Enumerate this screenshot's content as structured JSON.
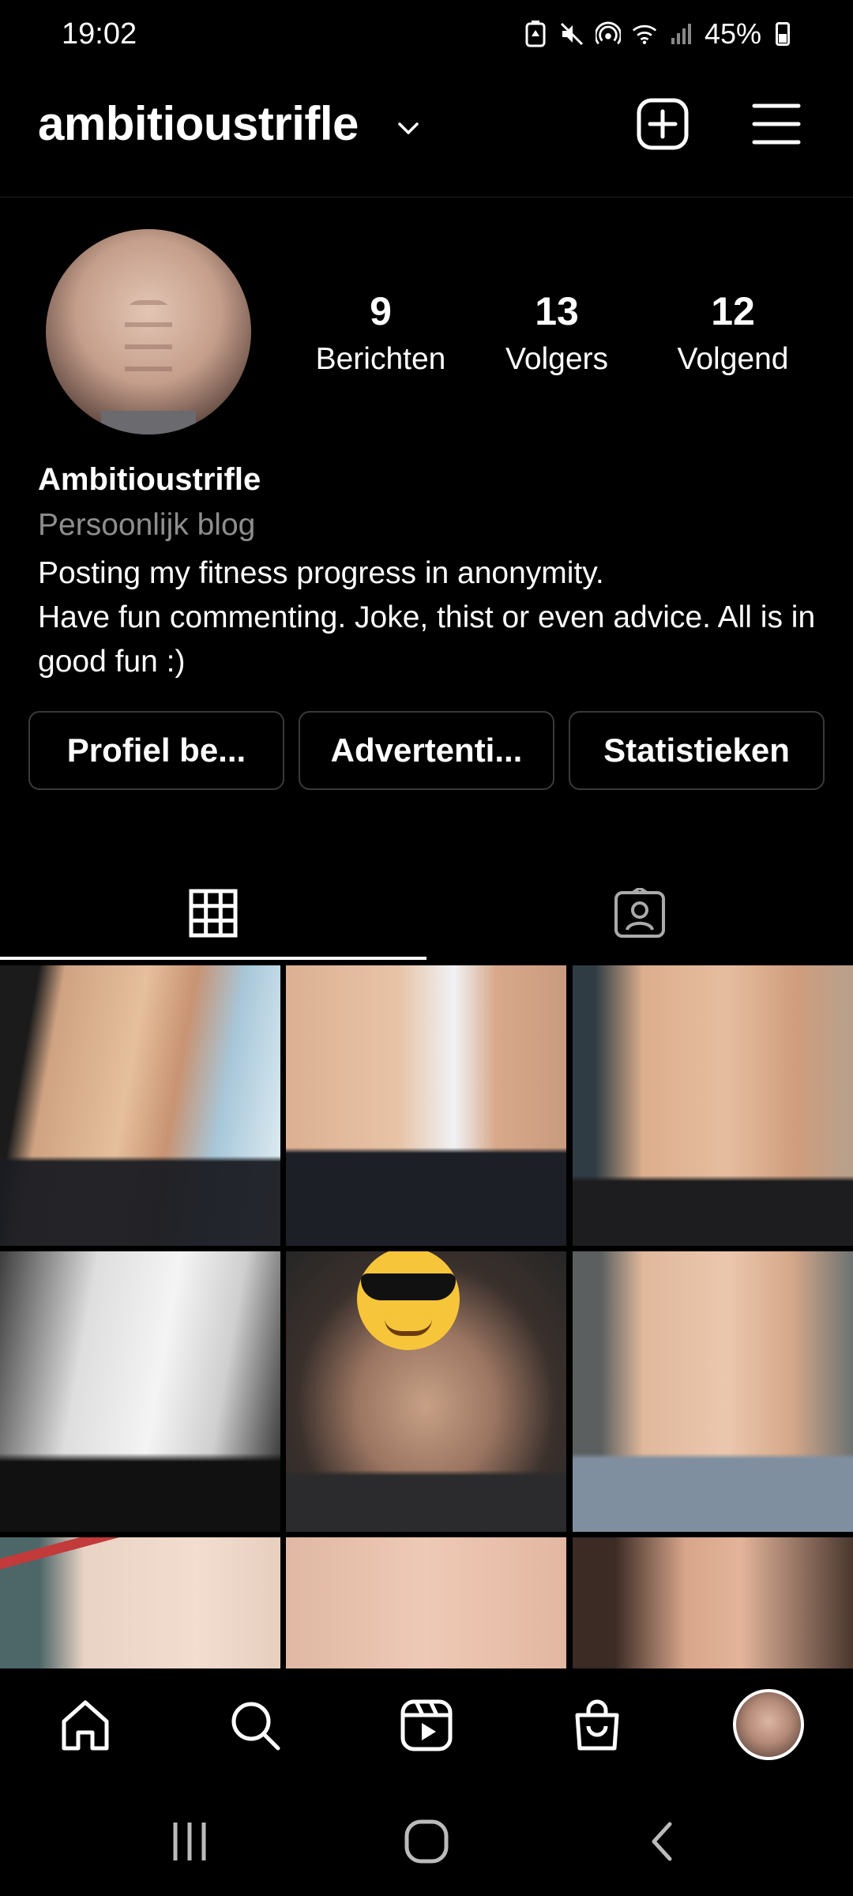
{
  "status_bar": {
    "time": "19:02",
    "battery_percent": "45%",
    "battery_level": 0.45,
    "icons": [
      "battery-saver-icon",
      "mute-icon",
      "hotspot-icon",
      "wifi-icon",
      "signal-icon"
    ]
  },
  "header": {
    "username": "ambitioustrifle",
    "icons": [
      "chevron-down-icon",
      "add-post-icon",
      "menu-icon"
    ]
  },
  "profile": {
    "stats": [
      {
        "count": "9",
        "label": "Berichten"
      },
      {
        "count": "13",
        "label": "Volgers"
      },
      {
        "count": "12",
        "label": "Volgend"
      }
    ],
    "display_name": "Ambitioustrifle",
    "category": "Persoonlijk blog",
    "bio_line1": "Posting my fitness progress in anonymity.",
    "bio_line2": "Have fun commenting. Joke, thist or even advice. All is in good fun :)",
    "buttons": [
      "Profiel be...",
      "Advertenti...",
      "Statistieken"
    ]
  },
  "tabs": {
    "active": "grid",
    "items": [
      "grid-icon",
      "tagged-icon"
    ]
  },
  "grid": {
    "post_count_visible": 9
  },
  "bottom_nav": {
    "items": [
      "home-icon",
      "search-icon",
      "reels-icon",
      "shop-icon",
      "profile-avatar"
    ]
  },
  "system_nav": {
    "items": [
      "recents-icon",
      "home-circle-icon",
      "back-icon"
    ]
  },
  "colors": {
    "background": "#000000",
    "text_primary": "#ffffff",
    "text_secondary": "#8e8e8e",
    "button_border": "#3a3a3a"
  }
}
